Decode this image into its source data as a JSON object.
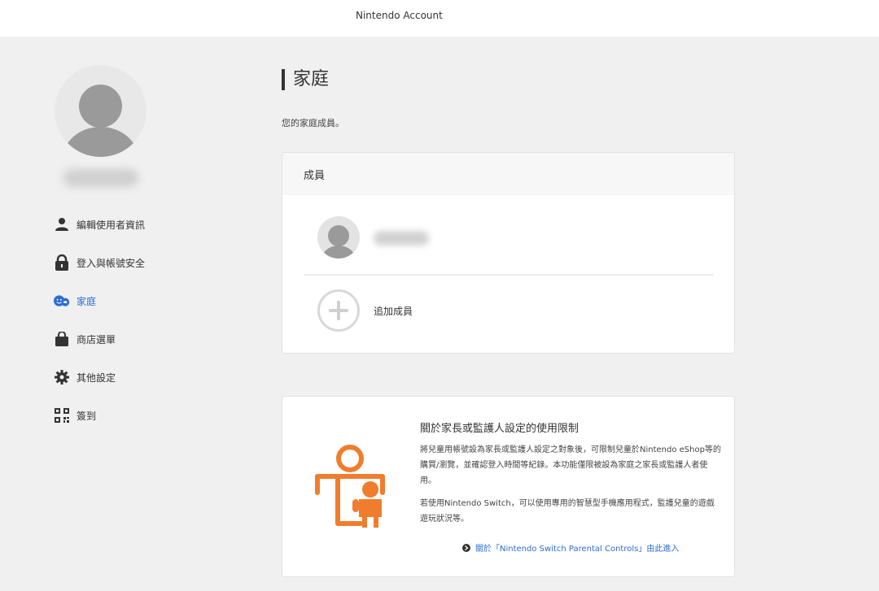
{
  "header": {
    "title": "Nintendo Account"
  },
  "sidebar": {
    "items": [
      {
        "label": "編輯使用者資訊",
        "icon": "person-icon"
      },
      {
        "label": "登入與帳號安全",
        "icon": "lock-icon"
      },
      {
        "label": "家庭",
        "icon": "family-icon",
        "active": true
      },
      {
        "label": "商店選單",
        "icon": "shopping-bag-icon"
      },
      {
        "label": "其他設定",
        "icon": "gear-icon"
      },
      {
        "label": "簽到",
        "icon": "qr-code-icon"
      }
    ]
  },
  "main": {
    "title": "家庭",
    "subtitle": "您的家庭成員。",
    "members_card": {
      "header": "成員",
      "add_label": "追加成員"
    },
    "info_card": {
      "title": "關於家長或監護人設定的使用限制",
      "paragraph1": "將兒童用帳號設為家長或監護人設定之對象後，可限制兒童於Nintendo eShop等的購買/瀏覽，並確認登入時間等紀錄。本功能僅限被設為家庭之家長或監護人者使用。",
      "paragraph2": "若使用Nintendo Switch，可以使用專用的智慧型手機應用程式，監護兒童的遊戲遊玩狀況等。",
      "link": "關於「Nintendo Switch Parental Controls」由此進入"
    }
  },
  "colors": {
    "accent": "#2b6cd4",
    "illustration": "#f07d2e"
  }
}
